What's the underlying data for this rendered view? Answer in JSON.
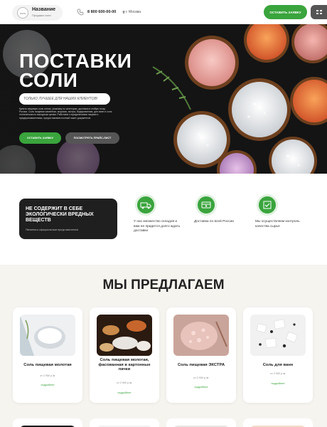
{
  "header": {
    "logo_mark": "лого",
    "logo_name": "Название",
    "logo_sub": "Продажа соли",
    "phone": "8 800 600-00-00",
    "city": "г. Москва",
    "cta_label": "ОСТАВИТЬ ЗАЯВКУ",
    "menu_icon": "menu-icon"
  },
  "hero": {
    "title_line1": "ПОСТАВКИ",
    "title_line2": "СОЛИ",
    "tagline": "ТОЛЬКО ЛУЧШЕЕ ДЛЯ НАШИХ КЛИЕНТОВ!",
    "description": "Купить пищевую соль оптом, упаковку по категории, доставка в любую точку России. Соль пищевая каменная, морская, экстра, йодированная, для ванн и соль техническая по выгодным ценам. Работаем с юридическими лицами и предпринимателями, предоставляем полный пакет документов.",
    "btn_primary": "ОСТАВИТЬ ЗАЯВКУ",
    "btn_secondary": "ПОСМОТРЕТЬ ПРАЙС-ЛИСТ"
  },
  "features": {
    "highlight_title": "НЕ СОДЕРЖИТ В СЕБЕ ЭКОЛОГИЧЕСКИ ВРЕДНЫХ ВЕЩЕСТВ",
    "highlight_sub": "Являемся официальным представителем",
    "items": [
      {
        "text": "У нас множество складов и вам не придется долго ждать доставки",
        "icon": "truck-icon"
      },
      {
        "text": "Доставка по всей России",
        "icon": "delivery-icon"
      },
      {
        "text": "Мы осуществляем контроль качества сырья",
        "icon": "quality-icon"
      }
    ]
  },
  "offers": {
    "title": "МЫ ПРЕДЛАГАЕМ",
    "products": [
      {
        "name": "Соль пищевая молотая",
        "price": "от 2 900 р./кг",
        "link": "подробнее"
      },
      {
        "name": "Соль пищевая молотая, фасованная в картонные пачки",
        "price": "от 2 900 р./кг",
        "link": "подробнее"
      },
      {
        "name": "Соль пищевая ЭКСТРА",
        "price": "от 2 900 р./кг",
        "link": "подробнее"
      },
      {
        "name": "Соль для ванн",
        "price": "от 2 900 р./кг",
        "link": "подробнее"
      }
    ]
  },
  "colors": {
    "accent": "#3aa43d",
    "dark": "#1f1f1f",
    "hero_bg": "#171717",
    "section_bg": "#f6f4ef"
  }
}
